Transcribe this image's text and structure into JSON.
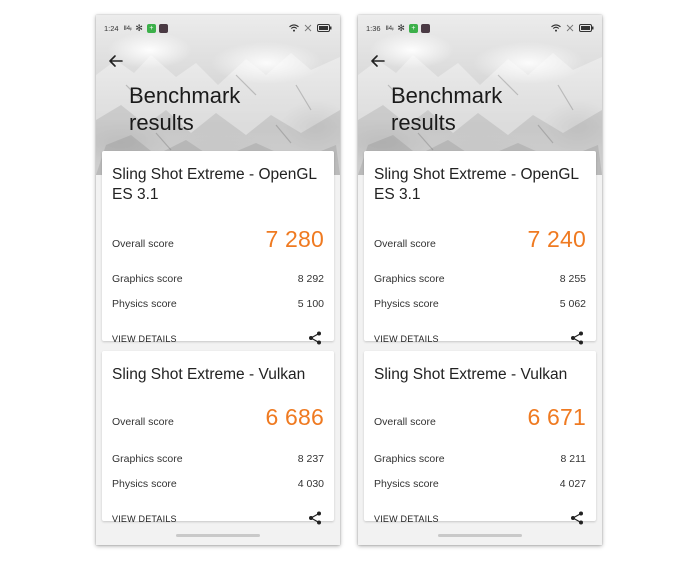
{
  "screens": [
    {
      "status": {
        "time": "1:24",
        "signal": "Ⅱ4ᵢₗ"
      },
      "title_line1": "Benchmark",
      "title_line2": "results",
      "cards": [
        {
          "title": "Sling Shot Extreme - OpenGL ES 3.1",
          "overall_label": "Overall score",
          "overall": "7 280",
          "graphics_label": "Graphics score",
          "graphics": "8 292",
          "physics_label": "Physics score",
          "physics": "5 100",
          "details_label": "VIEW DETAILS"
        },
        {
          "title": "Sling Shot Extreme - Vulkan",
          "overall_label": "Overall score",
          "overall": "6 686",
          "graphics_label": "Graphics score",
          "graphics": "8 237",
          "physics_label": "Physics score",
          "physics": "4 030",
          "details_label": "VIEW DETAILS"
        }
      ]
    },
    {
      "status": {
        "time": "1:36",
        "signal": "Ⅱ4ᵢₗ"
      },
      "title_line1": "Benchmark",
      "title_line2": "results",
      "cards": [
        {
          "title": "Sling Shot Extreme - OpenGL ES 3.1",
          "overall_label": "Overall score",
          "overall": "7 240",
          "graphics_label": "Graphics score",
          "graphics": "8 255",
          "physics_label": "Physics score",
          "physics": "5 062",
          "details_label": "VIEW DETAILS"
        },
        {
          "title": "Sling Shot Extreme - Vulkan",
          "overall_label": "Overall score",
          "overall": "6 671",
          "graphics_label": "Graphics score",
          "graphics": "8 211",
          "physics_label": "Physics score",
          "physics": "4 027",
          "details_label": "VIEW DETAILS"
        }
      ]
    }
  ],
  "icons": {
    "back": "back-arrow-icon",
    "share": "share-icon",
    "wifi": "wifi-icon",
    "battery": "battery-icon",
    "snow": "snowflake-icon"
  },
  "colors": {
    "accent_score": "#ef7a21",
    "status_app_green": "#3cb04a"
  }
}
